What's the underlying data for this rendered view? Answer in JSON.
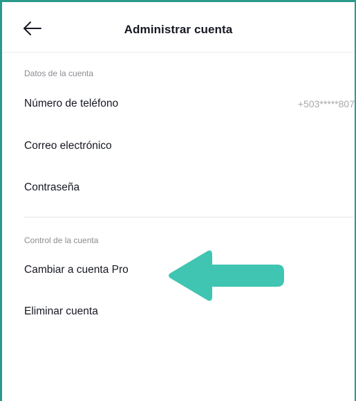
{
  "header": {
    "back_icon": "arrow-left-icon",
    "title": "Administrar cuenta"
  },
  "account_data": {
    "section_label": "Datos de la cuenta",
    "phone": {
      "label": "Número de teléfono",
      "value": "+503*****807"
    },
    "email": {
      "label": "Correo electrónico"
    },
    "password": {
      "label": "Contraseña"
    }
  },
  "account_control": {
    "section_label": "Control de la cuenta",
    "switch_pro": {
      "label": "Cambiar a cuenta Pro"
    },
    "delete": {
      "label": "Eliminar cuenta"
    }
  },
  "annotation": {
    "icon": "pointer-arrow-icon",
    "color": "#40c5b2"
  },
  "colors": {
    "frame_border": "#2a9a8a",
    "text_primary": "#161823",
    "text_secondary": "#8a8b91",
    "value_text": "#a7a8ad"
  }
}
